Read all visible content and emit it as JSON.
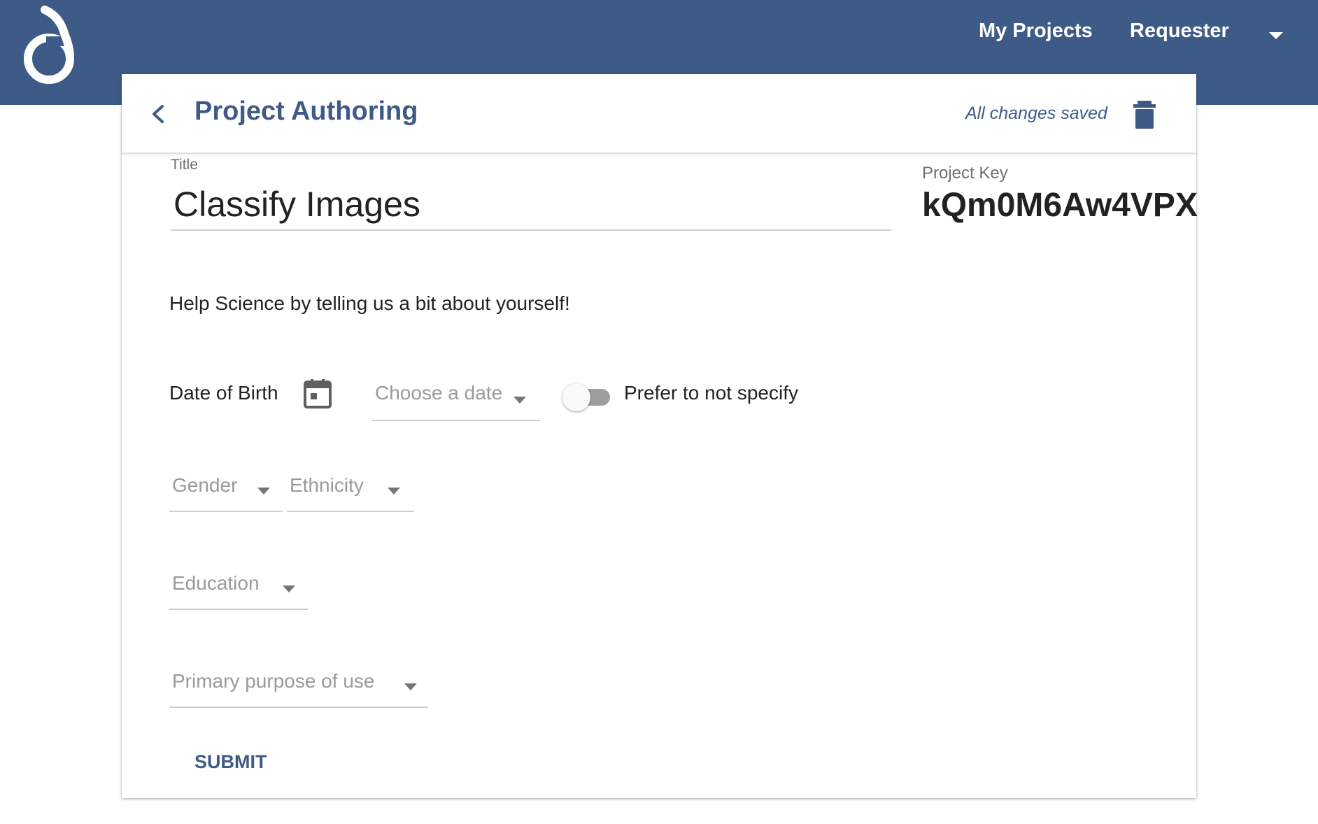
{
  "header": {
    "logo": "app-logo-icon",
    "nav": {
      "my_projects": "My Projects",
      "requester": "Requester"
    },
    "brand_color": "#3e5b88"
  },
  "card": {
    "page_title": "Project Authoring",
    "save_status": "All changes saved",
    "title_label": "Title",
    "title_value": "Classify Images",
    "project_key_label": "Project Key",
    "project_key_value": "kQm0M6Aw4VPX"
  },
  "form": {
    "intro": "Help Science by telling us a bit about yourself!",
    "dob_label": "Date of Birth",
    "date_placeholder": "Choose a date",
    "prefer_not_label": "Prefer to not specify",
    "prefer_not_checked": false,
    "gender_placeholder": "Gender",
    "ethnicity_placeholder": "Ethnicity",
    "education_placeholder": "Education",
    "purpose_placeholder": "Primary purpose of use",
    "submit_label": "SUBMIT"
  }
}
